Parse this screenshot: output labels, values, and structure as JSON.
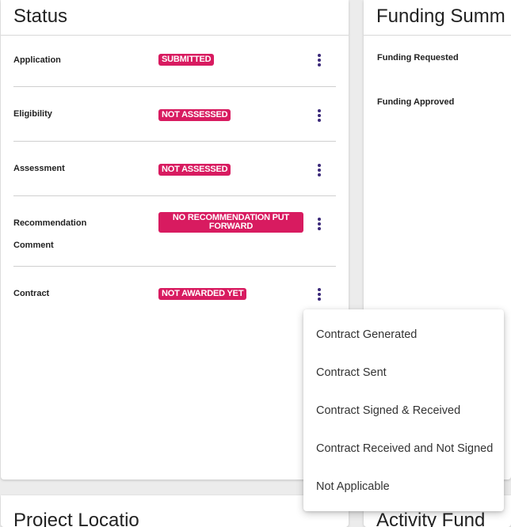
{
  "status": {
    "title": "Status",
    "rows": [
      {
        "label": "Application",
        "badge": "SUBMITTED"
      },
      {
        "label": "Eligibility",
        "badge": "NOT ASSESSED"
      },
      {
        "label": "Assessment",
        "badge": "NOT ASSESSED"
      },
      {
        "label_line1": "Recommendation",
        "label_line2": "Comment",
        "badge": "NO RECOMMENDATION PUT FORWARD"
      },
      {
        "label": "Contract",
        "badge": "NOT AWARDED YET"
      }
    ]
  },
  "funding": {
    "title": "Funding Summ",
    "requested_label": "Funding Requested",
    "approved_label": "Funding Approved"
  },
  "lower_cards": {
    "left_title": "Project Locatio",
    "right_title": "Activity Fund"
  },
  "contract_menu": {
    "items": [
      "Contract Generated",
      "Contract Sent",
      "Contract Signed & Received",
      "Contract Received and Not Signed",
      "Not Applicable"
    ]
  },
  "colors": {
    "badge": "#d81b60",
    "kebab": "#3c2a7a",
    "background": "#ececec"
  }
}
